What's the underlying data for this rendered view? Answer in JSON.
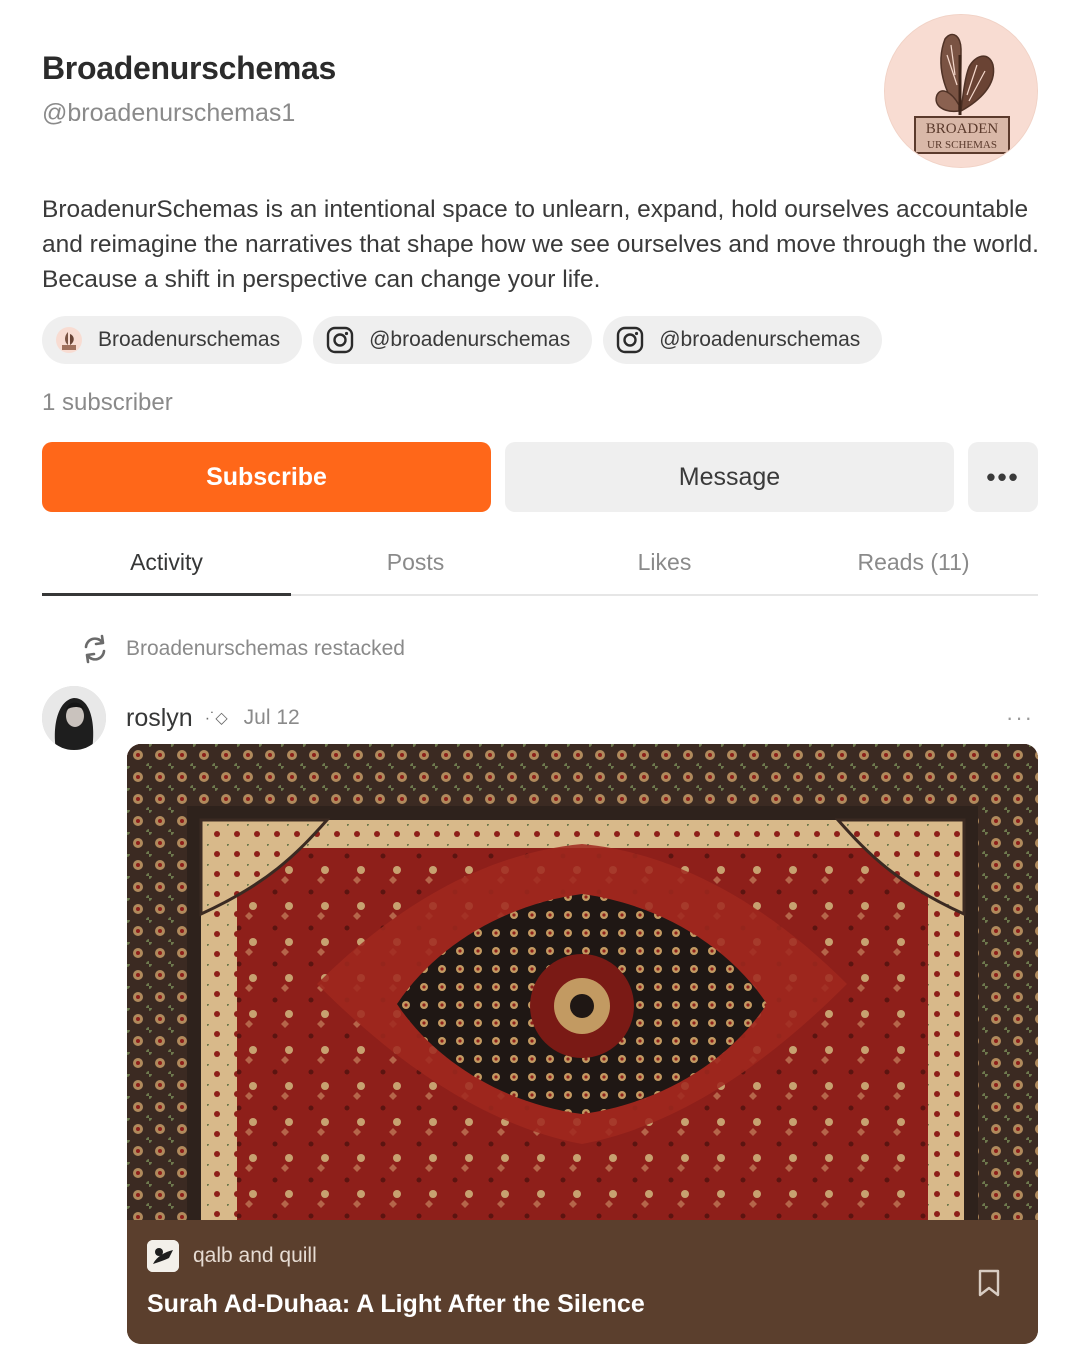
{
  "profile": {
    "name": "Broadenurschemas",
    "handle": "@broadenurschemas1",
    "bio": "BroadenurSchemas is an intentional space to unlearn, expand, hold ourselves accountable and reimagine the narratives that shape how we see ourselves and move through the world. Because a shift in perspective can change your life.",
    "logo_text_line1": "BROADEN",
    "logo_text_line2": "UR SCHEMAS",
    "subscribers": "1 subscriber"
  },
  "links": [
    {
      "label": "Broadenurschemas",
      "icon": "publication-icon"
    },
    {
      "label": "@broadenurschemas",
      "icon": "instagram-icon"
    },
    {
      "label": "@broadenurschemas",
      "icon": "instagram-icon"
    }
  ],
  "actions": {
    "subscribe": "Subscribe",
    "message": "Message",
    "more": "•••"
  },
  "tabs": [
    "Activity",
    "Posts",
    "Likes",
    "Reads (11)"
  ],
  "feed": {
    "restack_text": "Broadenurschemas restacked",
    "author": "roslyn",
    "author_badge": "·˙◇",
    "date": "Jul 12",
    "more": "···",
    "publication": "qalb and quill",
    "title": "Surah Ad-Duhaa: A Light After the Silence"
  },
  "colors": {
    "accent": "#ff6719",
    "card_footer": "#5b3f2d",
    "rug_red": "#8e1f1a"
  }
}
